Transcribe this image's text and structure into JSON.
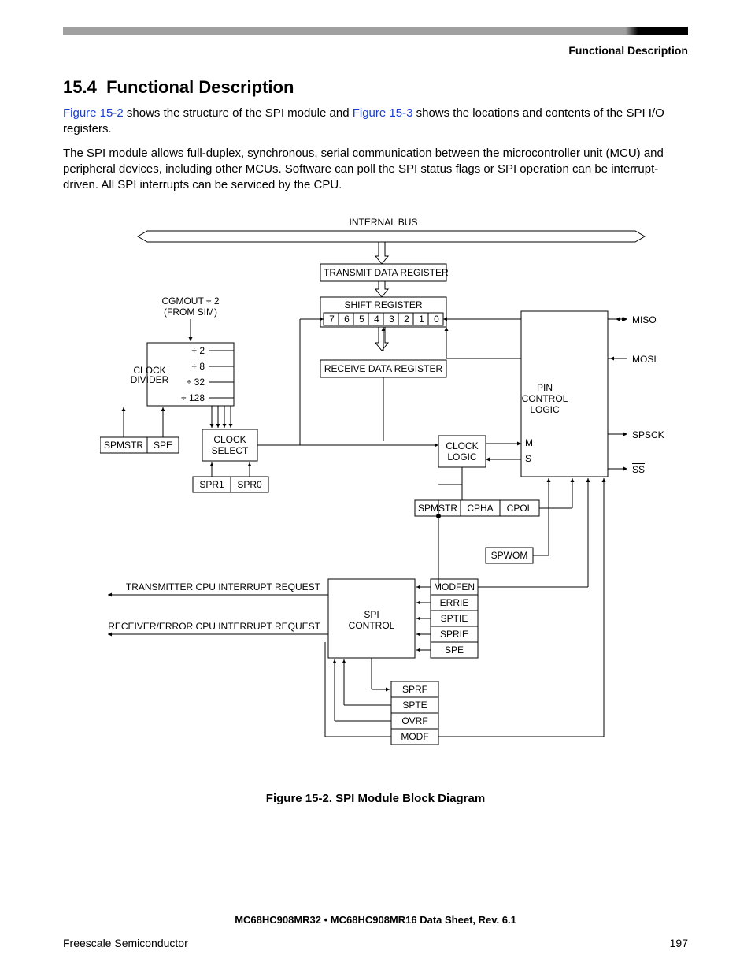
{
  "header_label": "Functional Description",
  "section_number": "15.4",
  "section_title": "Functional Description",
  "para1_prefix": "Figure 15-2",
  "para1_mid1": " shows the structure of the SPI module and ",
  "para1_link2": "Figure 15-3",
  "para1_tail": " shows the locations and contents of the SPI I/O registers.",
  "para2": "The SPI module allows full-duplex, synchronous, serial communication between the microcontroller unit (MCU) and peripheral devices, including other MCUs. Software can poll the SPI status flags or SPI operation can be interrupt-driven. All SPI interrupts can be serviced by the CPU.",
  "diagram": {
    "bus_label": "INTERNAL BUS",
    "tx_reg": "TRANSMIT DATA REGISTER",
    "shift_reg": "SHIFT REGISTER",
    "shift_bits": [
      "7",
      "6",
      "5",
      "4",
      "3",
      "2",
      "1",
      "0"
    ],
    "rx_reg": "RECEIVE DATA REGISTER",
    "clock_in1": "CGMOUT ÷ 2",
    "clock_in2": "(FROM SIM)",
    "div2": "÷ 2",
    "div8": "÷ 8",
    "div32": "÷ 32",
    "div128": "÷ 128",
    "clock_divider1": "CLOCK",
    "clock_divider2": "DIVIDER",
    "clock_select1": "CLOCK",
    "clock_select2": "SELECT",
    "spmstr": "SPMSTR",
    "spe": "SPE",
    "spr1": "SPR1",
    "spr0": "SPR0",
    "clock_logic1": "CLOCK",
    "clock_logic2": "LOGIC",
    "pin_ctrl1": "PIN",
    "pin_ctrl2": "CONTROL",
    "pin_ctrl3": "LOGIC",
    "m": "M",
    "s": "S",
    "miso": "MISO",
    "mosi": "MOSI",
    "spsck": "SPSCK",
    "ss": "SS",
    "cpha": "CPHA",
    "cpol": "CPOL",
    "spmstr2": "SPMSTR",
    "spwom": "SPWOM",
    "spi_ctrl1": "SPI",
    "spi_ctrl2": "CONTROL",
    "modfen": "MODFEN",
    "errie": "ERRIE",
    "sptie": "SPTIE",
    "sprie": "SPRIE",
    "spe2": "SPE",
    "sprf": "SPRF",
    "spte": "SPTE",
    "ovrf": "OVRF",
    "modf": "MODF",
    "tx_irq": "TRANSMITTER CPU INTERRUPT REQUEST",
    "rx_irq": "RECEIVER/ERROR CPU INTERRUPT REQUEST"
  },
  "figure_caption": "Figure 15-2. SPI Module Block Diagram",
  "footer_doc": "MC68HC908MR32 • MC68HC908MR16 Data Sheet, Rev. 6.1",
  "footer_left": "Freescale Semiconductor",
  "footer_right": "197"
}
